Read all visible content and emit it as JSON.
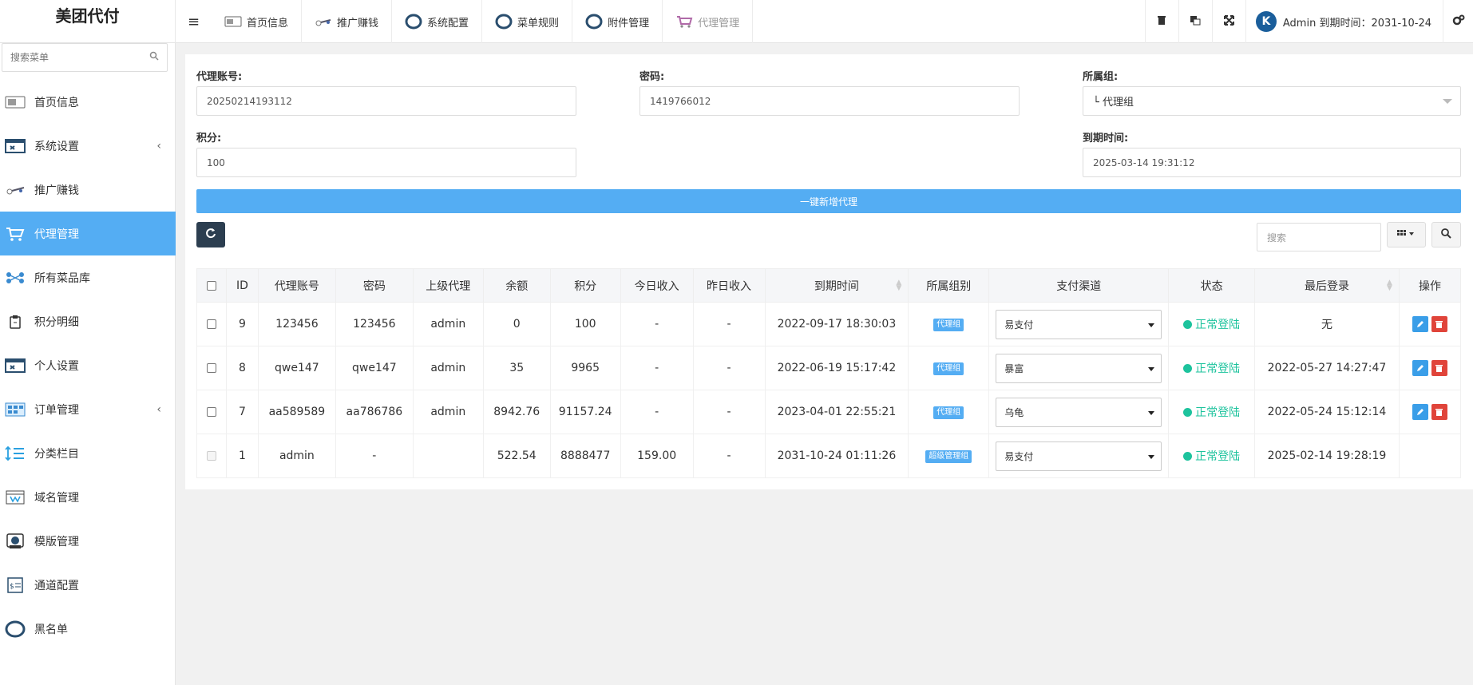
{
  "brand": {
    "title": "美团代付"
  },
  "top_tabs": [
    {
      "label": "首页信息",
      "icon": "card-icon"
    },
    {
      "label": "推广赚钱",
      "icon": "satellite-icon"
    },
    {
      "label": "系统配置",
      "icon": "ring-icon"
    },
    {
      "label": "菜单规则",
      "icon": "ring-icon"
    },
    {
      "label": "附件管理",
      "icon": "ring-icon"
    },
    {
      "label": "代理管理",
      "icon": "cart-icon"
    }
  ],
  "top_right": {
    "user_text": "Admin 到期时间：2031-10-24",
    "avatar_letter": "K"
  },
  "sidebar": {
    "search_placeholder": "搜索菜单",
    "items": [
      {
        "label": "首页信息",
        "icon": "card-icon"
      },
      {
        "label": "系统设置",
        "icon": "window-icon",
        "arrow": "‹"
      },
      {
        "label": "推广赚钱",
        "icon": "satellite-icon"
      },
      {
        "label": "代理管理",
        "icon": "cart-icon"
      },
      {
        "label": "所有菜品库",
        "icon": "network-icon"
      },
      {
        "label": "积分明细",
        "icon": "clipboard-icon"
      },
      {
        "label": "个人设置",
        "icon": "window-icon"
      },
      {
        "label": "订单管理",
        "icon": "grid-doc-icon",
        "arrow": "‹"
      },
      {
        "label": "分类栏目",
        "icon": "sort-list-icon"
      },
      {
        "label": "域名管理",
        "icon": "browser-w-icon"
      },
      {
        "label": "模版管理",
        "icon": "template-icon"
      },
      {
        "label": "通道配置",
        "icon": "channel-icon"
      },
      {
        "label": "黑名单",
        "icon": "ring-icon"
      }
    ]
  },
  "form": {
    "account_label": "代理账号:",
    "account_value": "20250214193112",
    "password_label": "密码:",
    "password_value": "1419766012",
    "group_label": "所属组:",
    "group_value": "└ 代理组",
    "points_label": "积分:",
    "points_value": "100",
    "expire_label": "到期时间:",
    "expire_value": "2025-03-14 19:31:12",
    "add_button": "一键新增代理"
  },
  "toolbar": {
    "search_placeholder": "搜索"
  },
  "table": {
    "headers": [
      "ID",
      "代理账号",
      "密码",
      "上级代理",
      "余额",
      "积分",
      "今日收入",
      "昨日收入",
      "到期时间",
      "所属组别",
      "支付渠道",
      "状态",
      "最后登录",
      "操作"
    ],
    "rows": [
      {
        "id": "9",
        "account": "123456",
        "password": "123456",
        "parent": "admin",
        "balance": "0",
        "points": "100",
        "today": "-",
        "yesterday": "-",
        "expire": "2022-09-17 18:30:03",
        "group": "代理组",
        "pay": "易支付",
        "status": "正常登陆",
        "last_login": "无",
        "editable": true
      },
      {
        "id": "8",
        "account": "qwe147",
        "password": "qwe147",
        "parent": "admin",
        "balance": "35",
        "points": "9965",
        "today": "-",
        "yesterday": "-",
        "expire": "2022-06-19 15:17:42",
        "group": "代理组",
        "pay": "暴富",
        "status": "正常登陆",
        "last_login": "2022-05-27 14:27:47",
        "editable": true
      },
      {
        "id": "7",
        "account": "aa589589",
        "password": "aa786786",
        "parent": "admin",
        "balance": "8942.76",
        "points": "91157.24",
        "today": "-",
        "yesterday": "-",
        "expire": "2023-04-01 22:55:21",
        "group": "代理组",
        "pay": "乌龟",
        "status": "正常登陆",
        "last_login": "2022-05-24 15:12:14",
        "editable": true
      },
      {
        "id": "1",
        "account": "admin",
        "password": "-",
        "parent": "",
        "balance": "522.54",
        "points": "8888477",
        "today": "159.00",
        "yesterday": "-",
        "expire": "2031-10-24 01:11:26",
        "group": "超级管理组",
        "pay": "易支付",
        "status": "正常登陆",
        "last_login": "2025-02-14 19:28:19",
        "editable": false
      }
    ]
  },
  "colors": {
    "accent": "#54adf3",
    "status_ok": "#1dc39d",
    "danger": "#e0443a",
    "dark_button": "#2c3e50"
  }
}
